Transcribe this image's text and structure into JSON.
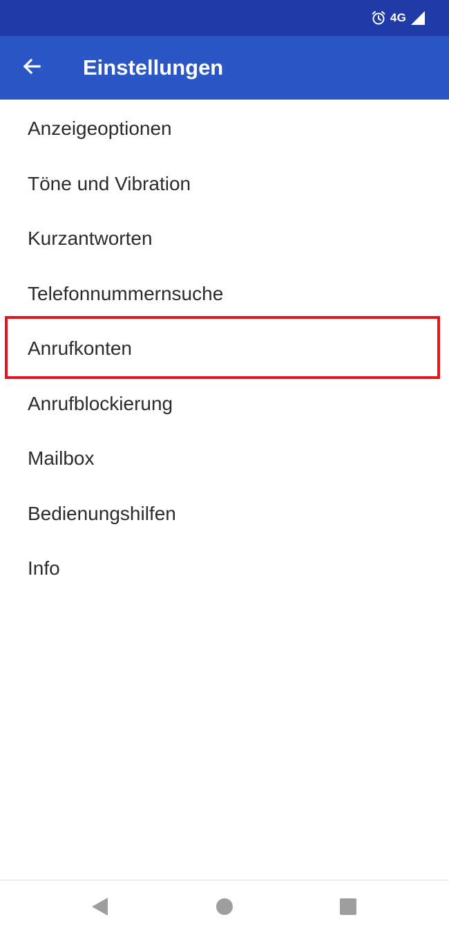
{
  "status_bar": {
    "network_label": "4G",
    "icons": [
      "alarm-icon",
      "cell-signal-icon"
    ]
  },
  "app_bar": {
    "title": "Einstellungen",
    "back_icon": "arrow-left-icon"
  },
  "settings": {
    "items": [
      {
        "label": "Anzeigeoptionen"
      },
      {
        "label": "Töne und Vibration"
      },
      {
        "label": "Kurzantworten"
      },
      {
        "label": "Telefonnummernsuche"
      },
      {
        "label": "Anrufkonten",
        "highlighted": true
      },
      {
        "label": "Anrufblockierung"
      },
      {
        "label": "Mailbox"
      },
      {
        "label": "Bedienungshilfen"
      },
      {
        "label": "Info"
      }
    ]
  },
  "navigation_bar": {
    "buttons": [
      "nav-back-icon",
      "nav-home-icon",
      "nav-recents-icon"
    ]
  },
  "colors": {
    "status_bar": "#1f3ba8",
    "app_bar": "#2b57c6",
    "highlight": "#e8141b",
    "text": "#2b2b2b"
  }
}
